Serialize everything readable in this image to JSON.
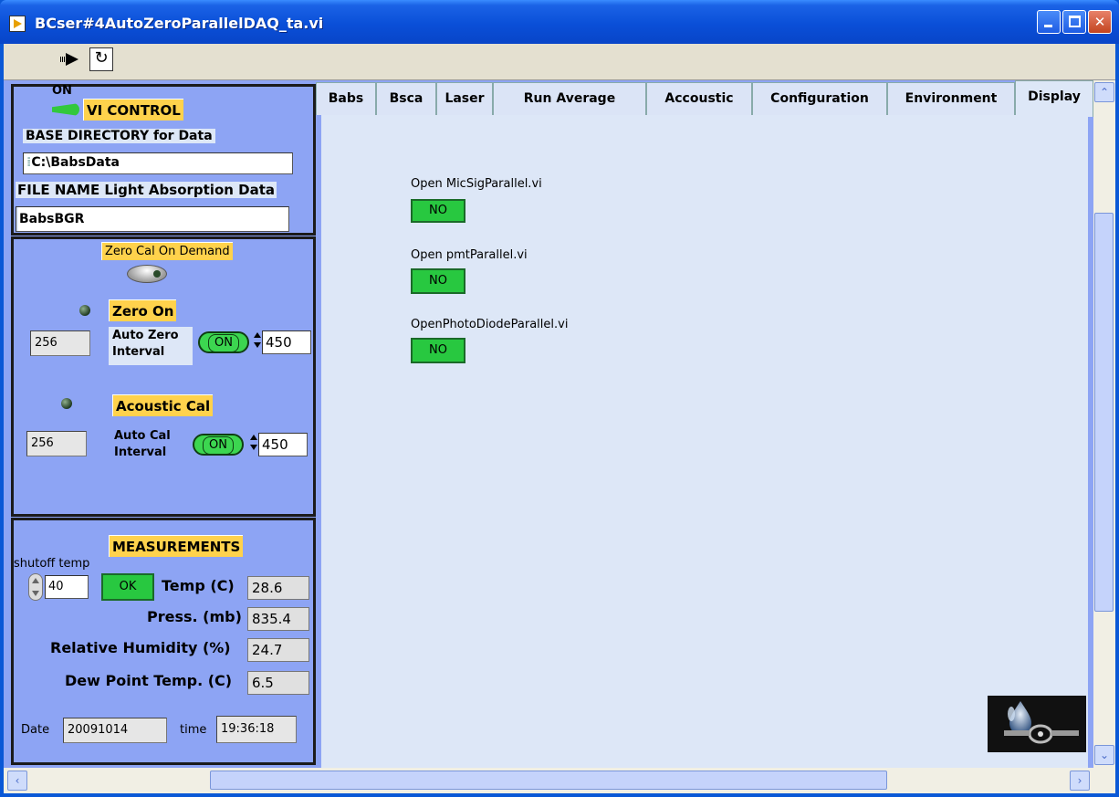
{
  "window": {
    "title": "BCser#4AutoZeroParallelDAQ_ta.vi"
  },
  "vi_control": {
    "on_label": "ON",
    "title": "VI CONTROL",
    "base_dir_label": "BASE DIRECTORY for Data",
    "base_dir_value": "C:\\BabsData",
    "file_name_label": "FILE NAME Light Absorption Data",
    "file_name_value": "BabsBGR"
  },
  "zero_cal": {
    "title": "Zero Cal On Demand",
    "zero_on_label": "Zero On",
    "zero_count": "256",
    "auto_zero_label_1": "Auto Zero",
    "auto_zero_label_2": "Interval",
    "auto_zero_toggle": "ON",
    "auto_zero_interval": "450",
    "acoustic_label": "Acoustic Cal",
    "acoustic_count": "256",
    "auto_cal_label_1": "Auto Cal",
    "auto_cal_label_2": "Interval",
    "auto_cal_toggle": "ON",
    "auto_cal_interval": "450"
  },
  "measurements": {
    "title": "MEASUREMENTS",
    "shutoff_label": "shutoff temp",
    "shutoff_value": "40",
    "ok_label": "OK",
    "temp_label": "Temp (C)",
    "temp_value": "28.6",
    "press_label": "Press. (mb)",
    "press_value": "835.4",
    "rh_label": "Relative Humidity (%)",
    "rh_value": "24.7",
    "dew_label": "Dew Point Temp. (C)",
    "dew_value": "6.5",
    "date_label": "Date",
    "date_value": "20091014",
    "time_label": "time",
    "time_value": "19:36:18"
  },
  "tabs": [
    "Babs",
    "Bsca",
    "Laser",
    "Run Average",
    "Accoustic",
    "Configuration",
    "Environment",
    "Display"
  ],
  "active_tab": "Display",
  "display": {
    "mic_label": "Open MicSigParallel.vi",
    "mic_value": "NO",
    "pmt_label": "Open pmtParallel.vi",
    "pmt_value": "NO",
    "photo_label": "OpenPhotoDiodeParallel.vi",
    "photo_value": "NO"
  },
  "colors": {
    "panel": "#8da4f4",
    "accent_label": "#ffd24c",
    "button_green": "#28c840",
    "tab_page": "#dde7f7"
  }
}
